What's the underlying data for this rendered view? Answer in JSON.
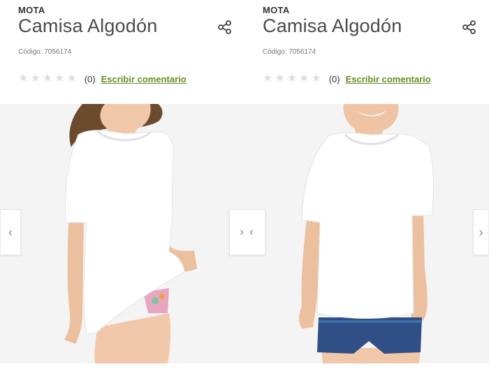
{
  "colors": {
    "link": "#6a8d26",
    "star_empty": "#dedede",
    "title": "#4a4a4a",
    "image_background": "#f3f3f3"
  },
  "products": [
    {
      "brand": "MOTA",
      "title": "Camisa Algodón",
      "code_label": "Código:",
      "code_value": "7056174",
      "rating_count": "(0)",
      "comment_link": "Escribir comentario",
      "rating_stars": 0,
      "share_icon": "share-icon",
      "image_subject": "girl"
    },
    {
      "brand": "MOTA",
      "title": "Camisa Algodón",
      "code_label": "Código:",
      "code_value": "7056174",
      "rating_count": "(0)",
      "comment_link": "Escribir comentario",
      "rating_stars": 0,
      "share_icon": "share-icon",
      "image_subject": "boy"
    }
  ],
  "navigation": {
    "prev_glyph": "‹",
    "compare_glyph": "› ‹",
    "next_glyph": "›"
  }
}
